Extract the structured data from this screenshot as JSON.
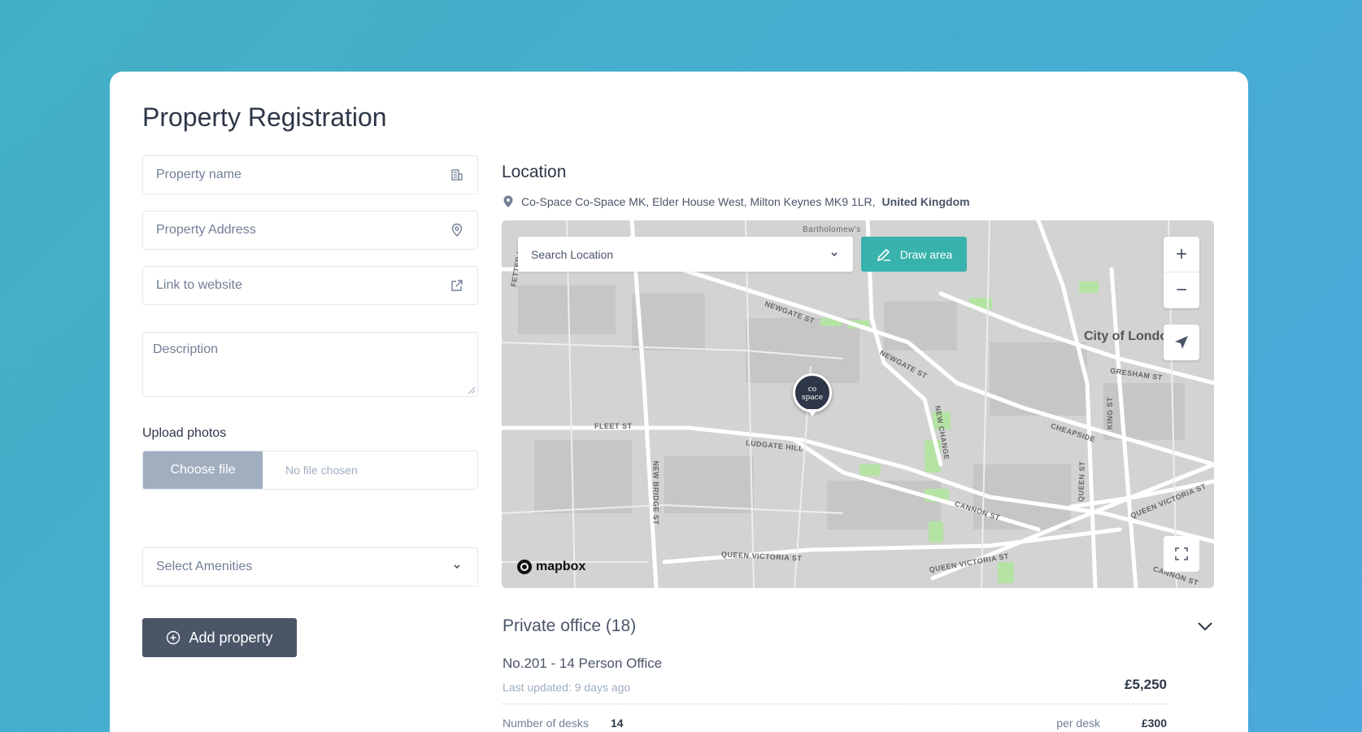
{
  "page": {
    "title": "Property Registration"
  },
  "form": {
    "property_name_placeholder": "Property name",
    "property_address_placeholder": "Property Address",
    "website_placeholder": "Link to website",
    "description_placeholder": "Description",
    "upload_label": "Upload photos",
    "choose_file": "Choose file",
    "no_file": "No file chosen",
    "amenities_placeholder": "Select Amenities",
    "add_button": "Add property"
  },
  "location": {
    "title": "Location",
    "address_prefix": "Co-Space Co-Space MK, Elder House West, Milton Keynes MK9 1LR,",
    "country": "United Kingdom"
  },
  "map": {
    "search_placeholder": "Search Location",
    "draw_label": "Draw area",
    "zoom_in": "+",
    "zoom_out": "−",
    "attribution": "mapbox",
    "pin_text_line1": "co",
    "pin_text_line2": "space",
    "city_label": "City of Londo",
    "streets": [
      "NEWGATE ST",
      "NEWGATE ST",
      "FLEET ST",
      "LUDGATE HILL",
      "NEW BRIDGE ST",
      "NEW CHANGE",
      "CHEAPSIDE",
      "GRESHAM ST",
      "KING ST",
      "QUEEN ST",
      "CANNON ST",
      "QUEEN VICTORIA ST",
      "QUEEN VICTORIA ST",
      "QUEEN VICTORIA ST",
      "CANNON ST",
      "Bartholomew's",
      "FETTER LN"
    ],
    "water_color": "#b5e3a4"
  },
  "offices": {
    "header": "Private office (18)",
    "item": {
      "name": "No.201 - 14 Person Office",
      "updated": "Last updated: 9 days ago",
      "price": "£5,250",
      "desks_label": "Number of desks",
      "desks_value": "14",
      "per_desk_label": "per desk",
      "per_desk_value": "£300"
    }
  },
  "colors": {
    "accent": "#38b2ac",
    "primary_button": "#4a5568"
  }
}
